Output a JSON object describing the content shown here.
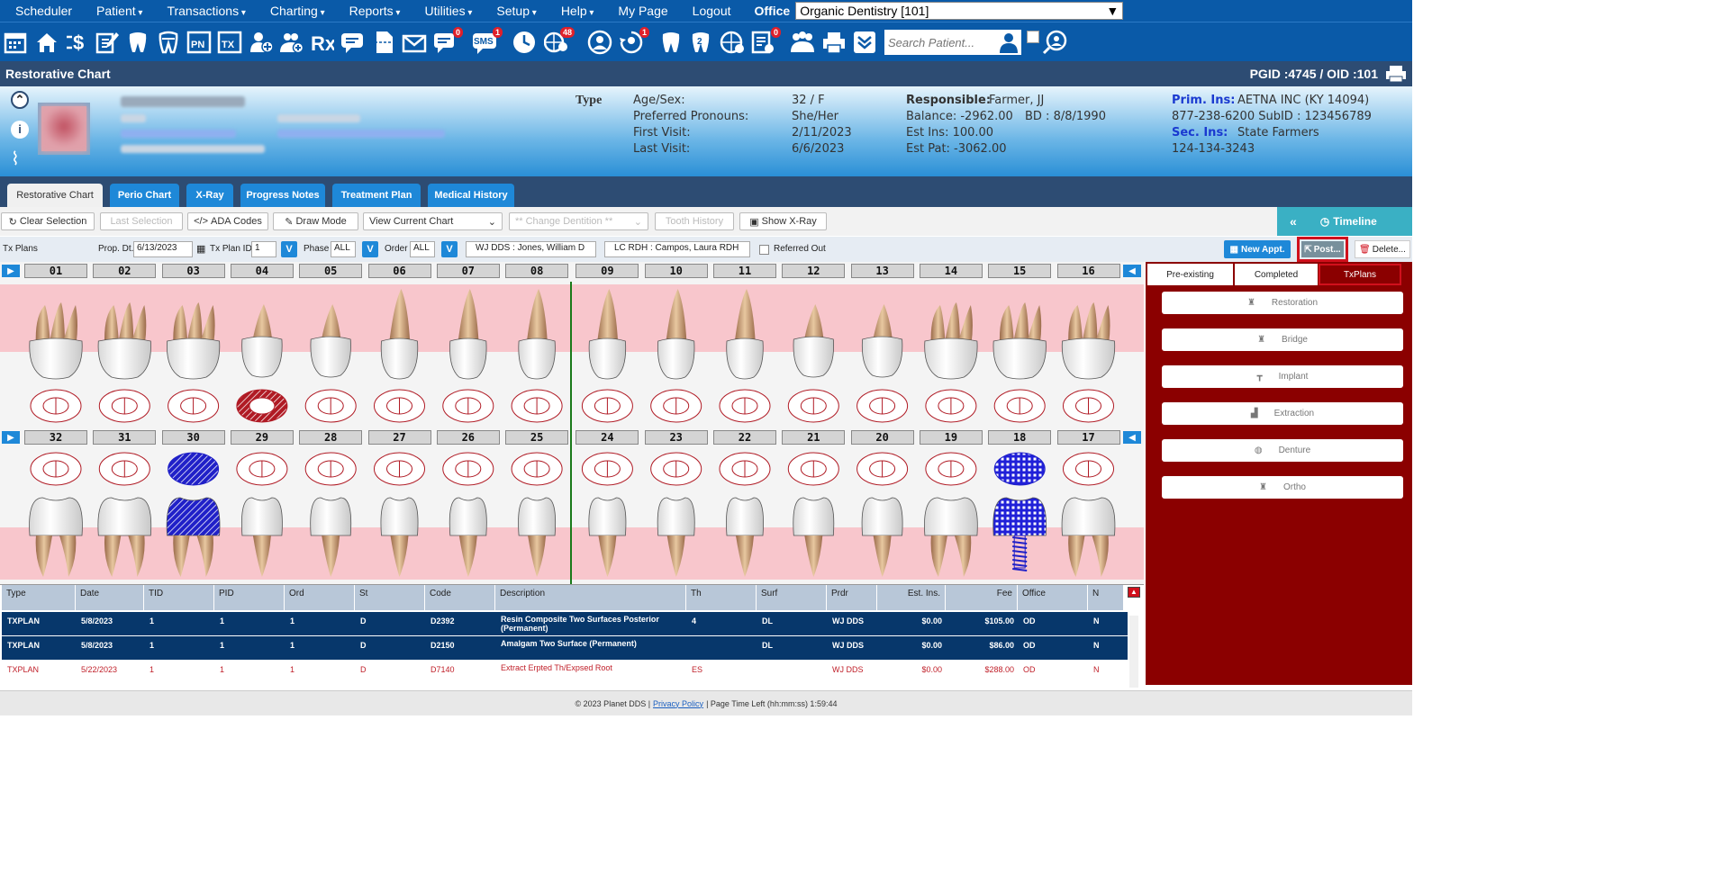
{
  "menu": [
    "Scheduler",
    "Patient",
    "Transactions",
    "Charting",
    "Reports",
    "Utilities",
    "Setup",
    "Help",
    "My Page",
    "Logout"
  ],
  "menu_dropdown": [
    false,
    true,
    true,
    true,
    true,
    true,
    true,
    true,
    false,
    false
  ],
  "office": {
    "label": "Office",
    "value": "Organic Dentistry [101]"
  },
  "toolbar": {
    "search_placeholder": "Search Patient...",
    "badges": {
      "messages": "0",
      "sms": "1",
      "web": "48",
      "recall": "1",
      "forms": "0"
    },
    "sms_label": "SMS"
  },
  "title": {
    "text": "Restorative Chart",
    "ids": "PGID :4745  /  OID :101"
  },
  "patient": {
    "type_label": "Type",
    "age_sex_label": "Age/Sex:",
    "age_sex": "32 / F",
    "pronouns_label": "Preferred Pronouns:",
    "pronouns": "She/Her",
    "first_visit_label": "First Visit:",
    "first_visit": "2/11/2023",
    "last_visit_label": "Last Visit:",
    "last_visit": "6/6/2023",
    "responsible_label": "Responsible:",
    "responsible": "Farmer, JJ",
    "balance": "Balance: -2962.00",
    "bd": "BD : 8/8/1990",
    "est_ins": "Est Ins:  100.00",
    "est_pat": "Est Pat: -3062.00",
    "prim_ins_label": "Prim. Ins:",
    "prim_ins": "AETNA INC (KY 14094)",
    "prim_phone": "877-238-6200 SubID : 123456789",
    "sec_ins_label": "Sec. Ins:",
    "sec_ins": "State Farmers",
    "sec_phone": "124-134-3243"
  },
  "tabs": [
    "Restorative Chart",
    "Perio Chart",
    "X-Ray",
    "Progress Notes",
    "Treatment Plan",
    "Medical History"
  ],
  "controls": {
    "clear": "Clear Selection",
    "last": "Last Selection",
    "ada": "ADA Codes",
    "draw": "Draw Mode",
    "view": "View Current Chart",
    "dentition": "** Change Dentition **",
    "history": "Tooth History",
    "xray": "Show X-Ray",
    "timeline": "Timeline"
  },
  "txplan": {
    "label": "Tx Plans",
    "prop_dt_label": "Prop. Dt.",
    "prop_dt": "6/13/2023",
    "plan_id_label": "Tx Plan ID",
    "plan_id": "1",
    "phase_label": "Phase",
    "phase": "ALL",
    "order_label": "Order",
    "order": "ALL",
    "v": "V",
    "provider1": "WJ DDS : Jones, William D",
    "provider2": "LC RDH : Campos, Laura RDH",
    "referred": "Referred Out",
    "new_appt": "New Appt.",
    "post": "Post...",
    "delete": "Delete..."
  },
  "teeth": {
    "upper": [
      "01",
      "02",
      "03",
      "04",
      "05",
      "06",
      "07",
      "08",
      "09",
      "10",
      "11",
      "12",
      "13",
      "14",
      "15",
      "16"
    ],
    "lower": [
      "32",
      "31",
      "30",
      "29",
      "28",
      "27",
      "26",
      "25",
      "24",
      "23",
      "22",
      "21",
      "20",
      "19",
      "18",
      "17"
    ]
  },
  "grid": {
    "headers": [
      "Type",
      "Date",
      "TID",
      "PID",
      "Ord",
      "St",
      "Code",
      "Description",
      "Th",
      "Surf",
      "Prdr",
      "Est. Ins.",
      "Fee",
      "Office",
      "N"
    ],
    "rows": [
      [
        "TXPLAN",
        "5/8/2023",
        "1",
        "1",
        "1",
        "D",
        "D2392",
        "Resin Composite Two Surfaces Posterior (Permanent)",
        "4",
        "DL",
        "WJ DDS",
        "$0.00",
        "$105.00",
        "OD",
        "N"
      ],
      [
        "TXPLAN",
        "5/8/2023",
        "1",
        "1",
        "1",
        "D",
        "D2150",
        "Amalgam Two Surface (Permanent)",
        "",
        "DL",
        "WJ DDS",
        "$0.00",
        "$86.00",
        "OD",
        "N"
      ],
      [
        "TXPLAN",
        "5/22/2023",
        "1",
        "1",
        "1",
        "D",
        "D7140",
        "Extract Erpted Th/Expsed Root",
        "ES",
        "",
        "WJ DDS",
        "$0.00",
        "$288.00",
        "OD",
        "N"
      ]
    ]
  },
  "side": {
    "tabs": [
      "Pre-existing",
      "Completed",
      "TxPlans"
    ],
    "buttons": [
      "Restoration",
      "Bridge",
      "Implant",
      "Extraction",
      "Denture",
      "Ortho"
    ]
  },
  "footer": {
    "copyright": "© 2023 Planet DDS |",
    "privacy": "Privacy Policy",
    "time": "|  Page Time Left (hh:mm:ss) 1:59:44"
  },
  "colors": {
    "menubar": "#0a5aa8",
    "title": "#2d4c73",
    "tab": "#1e88d8",
    "sidepanel": "#8b0000",
    "selected_row": "#07376b",
    "treatment_blue": "#2222cc",
    "treatment_red": "#b01a24"
  }
}
